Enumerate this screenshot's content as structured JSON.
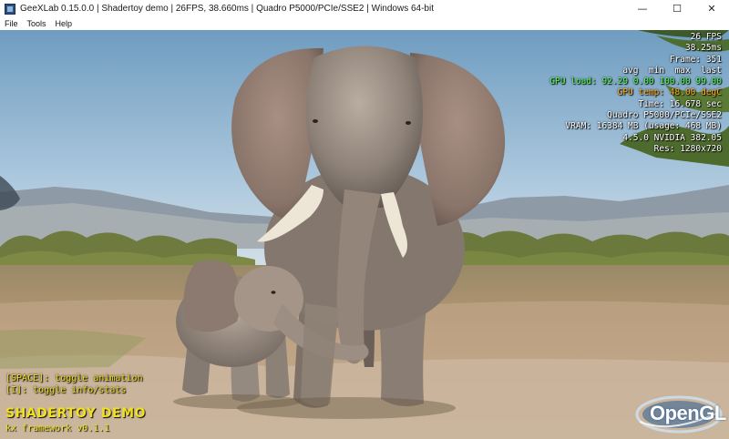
{
  "window": {
    "title": "GeeXLab 0.15.0.0 | Shadertoy demo | 26FPS, 38.660ms | Quadro P5000/PCIe/SSE2 | Windows 64-bit",
    "controls": {
      "minimize": "—",
      "maximize": "☐",
      "close": "✕"
    }
  },
  "menu": {
    "items": [
      "File",
      "Tools",
      "Help"
    ]
  },
  "hud": {
    "fps": "26 FPS",
    "frame_time": "38.25ms",
    "frame": "Frame: 351",
    "stats_header": "avg  min  max  last",
    "gpu_load": "GPU load: 92.29 0.00 100.00 99.00",
    "gpu_temp": "GPU temp: 48.00 degC",
    "time": "Time: 16.678 sec",
    "gpu_name": "Quadro P5000/PCIe/SSE2",
    "vram": "VRAM: 16384 MB (usage: 468 MB)",
    "driver": "4.5.0 NVIDIA 382.05",
    "resolution": "Res: 1280x720"
  },
  "help": {
    "line1": "[SPACE]: toggle animation",
    "line2": "[I]: toggle info/stats"
  },
  "demo": {
    "title": "SHADERTOY DEMO",
    "subtitle": "kx framework v0.1.1"
  },
  "logo": {
    "text": "OpenGL"
  },
  "colors": {
    "hud_green": "#55ff55",
    "hud_orange": "#ffb020",
    "help_yellow": "#f0e020"
  }
}
